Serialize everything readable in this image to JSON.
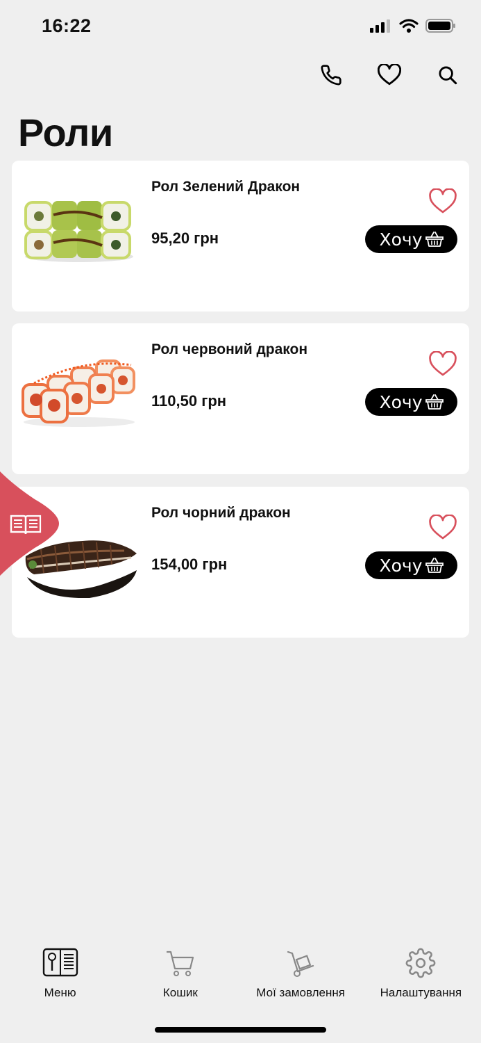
{
  "status": {
    "time": "16:22"
  },
  "page": {
    "title": "Роли"
  },
  "products": [
    {
      "name": "Рол Зелений Дракон",
      "price": "95,20 грн",
      "button": "Хочу"
    },
    {
      "name": "Рол червоний дракон",
      "price": "110,50 грн",
      "button": "Хочу"
    },
    {
      "name": "Рол чорний дракон",
      "price": "154,00 грн",
      "button": "Хочу"
    }
  ],
  "tabbar": {
    "items": [
      {
        "label": "Меню",
        "icon": "menu-book-icon"
      },
      {
        "label": "Кошик",
        "icon": "cart-icon"
      },
      {
        "label": "Мої замовлення",
        "icon": "hand-truck-icon"
      },
      {
        "label": "Налаштування",
        "icon": "gear-icon"
      }
    ]
  },
  "colors": {
    "accent": "#d8505c",
    "background": "#efefef",
    "button": "#000000"
  }
}
